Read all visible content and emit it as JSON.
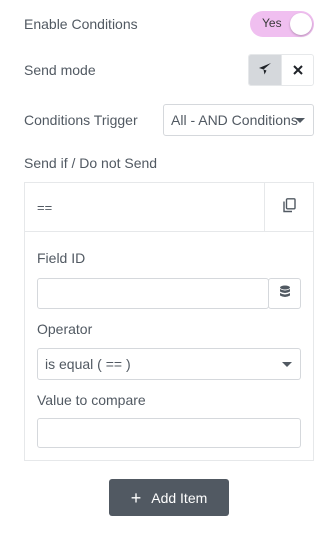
{
  "enable_conditions": {
    "label": "Enable Conditions",
    "toggle_text": "Yes",
    "state": "on"
  },
  "send_mode": {
    "label": "Send mode",
    "buttons": [
      {
        "icon": "paper-plane-icon",
        "active": true
      },
      {
        "icon": "close-icon",
        "active": false
      }
    ]
  },
  "conditions_trigger": {
    "label": "Conditions Trigger",
    "value": "All - AND Conditions"
  },
  "send_if": {
    "label": "Send if / Do not Send"
  },
  "repeater": {
    "item_title": "==",
    "copy_icon": "copy-icon",
    "field_id": {
      "label": "Field ID",
      "value": "",
      "icon": "database-icon"
    },
    "operator": {
      "label": "Operator",
      "value": "is equal ( == )"
    },
    "value_to_compare": {
      "label": "Value to compare",
      "value": ""
    }
  },
  "add_item": {
    "label": "Add Item",
    "icon": "plus-icon"
  },
  "colors": {
    "toggle_on": "#f0bff0",
    "text": "#515962",
    "button_bg": "#515962",
    "active_seg": "#d5d8dc"
  }
}
